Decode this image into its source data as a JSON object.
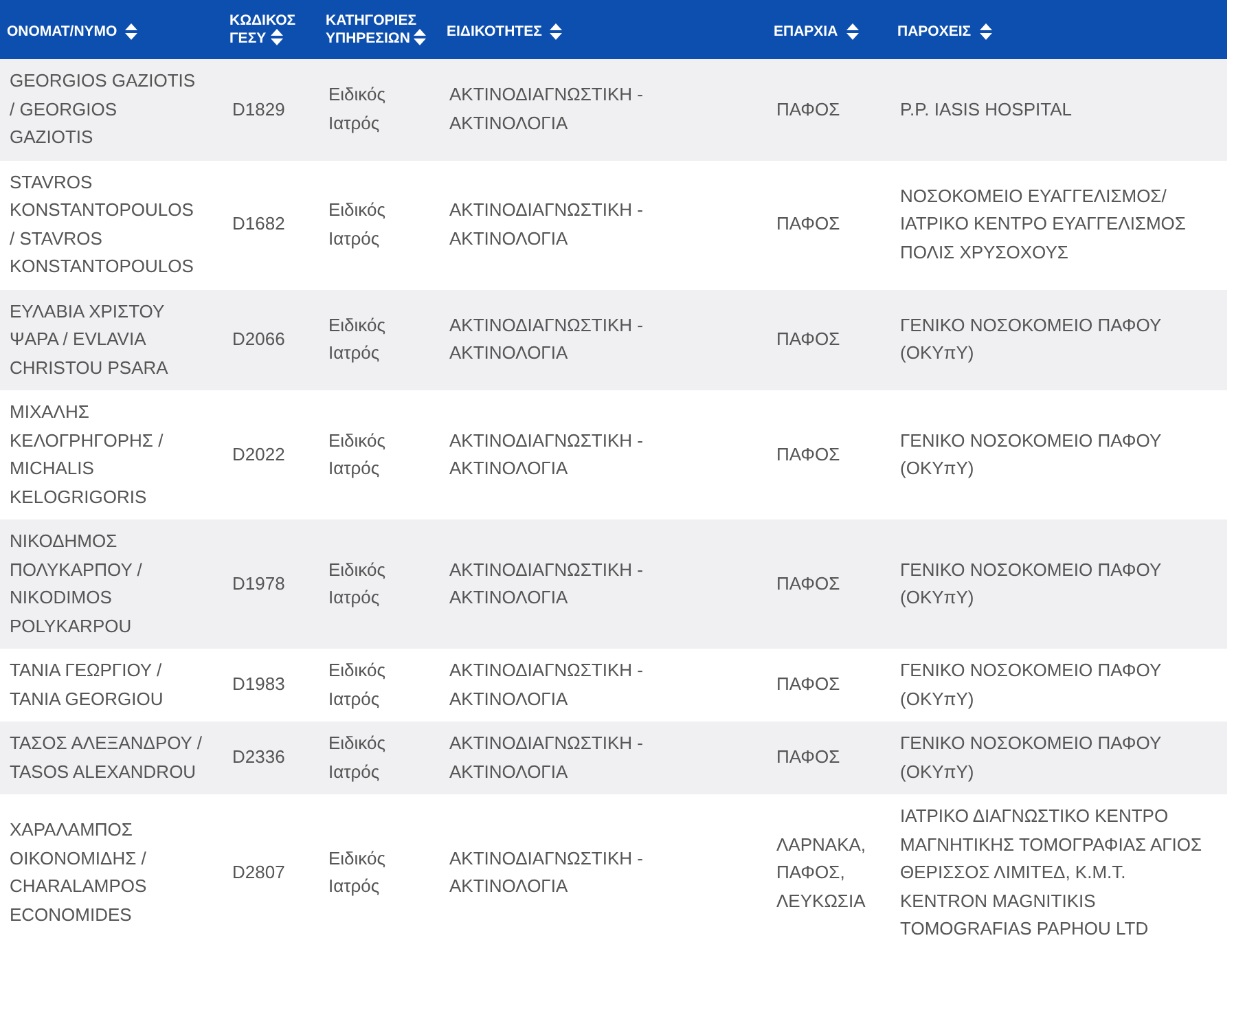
{
  "table": {
    "columns": [
      "ΟΝΟΜΑΤ/ΝΥΜΟ",
      "ΚΩΔΙΚΟΣ ΓΕΣΥ",
      "ΚΑΤΗΓΟΡΙΕΣ ΥΠΗΡΕΣΙΩΝ",
      "ΕΙΔΙΚΟΤΗΤΕΣ",
      "ΕΠΑΡΧΙΑ",
      "ΠΑΡΟΧΕΙΣ"
    ],
    "rows": [
      {
        "cells": [
          "GEORGIOS GAZIOTIS / GEORGIOS GAZIOTIS",
          "D1829",
          "Ειδικός Ιατρός",
          "ΑΚΤΙΝΟΔΙΑΓΝΩΣΤΙΚΗ - ΑΚΤΙΝΟΛΟΓΙΑ",
          "ΠΑΦΟΣ",
          "P.P. IASIS HOSPITAL"
        ]
      },
      {
        "cells": [
          "STAVROS KONSTANTOPOULOS / STAVROS KONSTANTOPOULOS",
          "D1682",
          "Ειδικός Ιατρός",
          "ΑΚΤΙΝΟΔΙΑΓΝΩΣΤΙΚΗ - ΑΚΤΙΝΟΛΟΓΙΑ",
          "ΠΑΦΟΣ",
          "ΝΟΣΟΚΟΜΕΙΟ ΕΥΑΓΓΕΛΙΣΜΟΣ/ ΙΑΤΡΙΚΟ ΚΕΝΤΡΟ ΕΥΑΓΓΕΛΙΣΜΟΣ ΠΟΛΙΣ ΧΡΥΣΟΧΟΥΣ"
        ]
      },
      {
        "cells": [
          "ΕΥΛΑΒΙΑ ΧΡΙΣΤΟΥ ΨΑΡΑ / EVLAVIA CHRISTOU PSARA",
          "D2066",
          "Ειδικός Ιατρός",
          "ΑΚΤΙΝΟΔΙΑΓΝΩΣΤΙΚΗ - ΑΚΤΙΝΟΛΟΓΙΑ",
          "ΠΑΦΟΣ",
          "ΓΕΝΙΚΟ ΝΟΣΟΚΟΜΕΙΟ ΠΑΦΟΥ (ΟΚΥπΥ)"
        ]
      },
      {
        "cells": [
          "ΜΙΧΑΛΗΣ ΚΕΛΟΓΡΗΓΟΡΗΣ / MICHALIS KELOGRIGORIS",
          "D2022",
          "Ειδικός Ιατρός",
          "ΑΚΤΙΝΟΔΙΑΓΝΩΣΤΙΚΗ - ΑΚΤΙΝΟΛΟΓΙΑ",
          "ΠΑΦΟΣ",
          "ΓΕΝΙΚΟ ΝΟΣΟΚΟΜΕΙΟ ΠΑΦΟΥ (ΟΚΥπΥ)"
        ]
      },
      {
        "cells": [
          "ΝΙΚΟΔΗΜΟΣ ΠΟΛΥΚΑΡΠΟΥ / NIKODIMOS POLYKARPOU",
          "D1978",
          "Ειδικός Ιατρός",
          "ΑΚΤΙΝΟΔΙΑΓΝΩΣΤΙΚΗ - ΑΚΤΙΝΟΛΟΓΙΑ",
          "ΠΑΦΟΣ",
          "ΓΕΝΙΚΟ ΝΟΣΟΚΟΜΕΙΟ ΠΑΦΟΥ (ΟΚΥπΥ)"
        ]
      },
      {
        "cells": [
          "ΤΑΝΙΑ ΓΕΩΡΓΙΟΥ / TANIA GEORGIOU",
          "D1983",
          "Ειδικός Ιατρός",
          "ΑΚΤΙΝΟΔΙΑΓΝΩΣΤΙΚΗ - ΑΚΤΙΝΟΛΟΓΙΑ",
          "ΠΑΦΟΣ",
          "ΓΕΝΙΚΟ ΝΟΣΟΚΟΜΕΙΟ ΠΑΦΟΥ (ΟΚΥπΥ)"
        ]
      },
      {
        "cells": [
          "ΤΑΣΟΣ ΑΛΕΞΑΝΔΡΟΥ / TASOS ALEXANDROU",
          "D2336",
          "Ειδικός Ιατρός",
          "ΑΚΤΙΝΟΔΙΑΓΝΩΣΤΙΚΗ - ΑΚΤΙΝΟΛΟΓΙΑ",
          "ΠΑΦΟΣ",
          "ΓΕΝΙΚΟ ΝΟΣΟΚΟΜΕΙΟ ΠΑΦΟΥ (ΟΚΥπΥ)"
        ]
      },
      {
        "cells": [
          "ΧΑΡΑΛΑΜΠΟΣ ΟΙΚΟΝΟΜΙΔΗΣ / CHARALAMPOS ECONOMIDES",
          "D2807",
          "Ειδικός Ιατρός",
          "ΑΚΤΙΝΟΔΙΑΓΝΩΣΤΙΚΗ - ΑΚΤΙΝΟΛΟΓΙΑ",
          "ΛΑΡΝΑΚΑ, ΠΑΦΟΣ, ΛΕΥΚΩΣΙΑ",
          "ΙΑΤΡΙΚΟ ΔΙΑΓΝΩΣΤΙΚΟ ΚΕΝΤΡΟ ΜΑΓΝΗΤΙΚΗΣ ΤΟΜΟΓΡΑΦΙΑΣ ΑΓΙΟΣ ΘΕΡΙΣΣΟΣ ΛΙΜΙΤΕΔ, Κ.Μ.Τ. KENTRON MAGNITIKIS TOMOGRAFIAS PAPHOU LTD"
        ]
      }
    ]
  }
}
